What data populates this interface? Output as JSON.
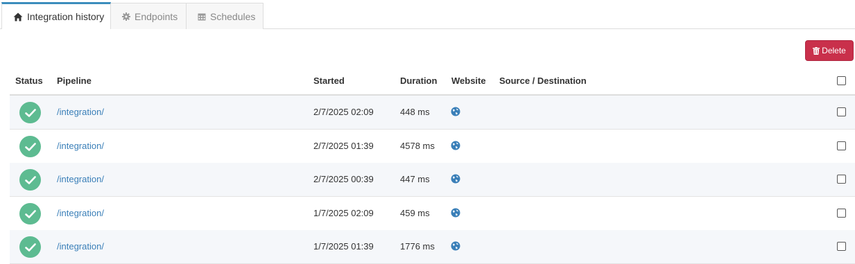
{
  "tabs": [
    {
      "label": "Integration history",
      "icon": "home-icon",
      "active": true
    },
    {
      "label": "Endpoints",
      "icon": "gear-icon",
      "active": false
    },
    {
      "label": "Schedules",
      "icon": "calendar-icon",
      "active": false
    }
  ],
  "toolbar": {
    "delete_label": "Delete",
    "delete_color": "#c9304b"
  },
  "table": {
    "headers": {
      "status": "Status",
      "pipeline": "Pipeline",
      "started": "Started",
      "duration": "Duration",
      "website": "Website",
      "source_destination": "Source / Destination"
    },
    "rows": [
      {
        "status": "success",
        "pipeline": "/integration/",
        "started": "2/7/2025 02:09",
        "duration": "448 ms",
        "website": "globe-icon",
        "source_destination": ""
      },
      {
        "status": "success",
        "pipeline": "/integration/",
        "started": "2/7/2025 01:39",
        "duration": "4578 ms",
        "website": "globe-icon",
        "source_destination": ""
      },
      {
        "status": "success",
        "pipeline": "/integration/",
        "started": "2/7/2025 00:39",
        "duration": "447 ms",
        "website": "globe-icon",
        "source_destination": ""
      },
      {
        "status": "success",
        "pipeline": "/integration/",
        "started": "1/7/2025 02:09",
        "duration": "459 ms",
        "website": "globe-icon",
        "source_destination": ""
      },
      {
        "status": "success",
        "pipeline": "/integration/",
        "started": "1/7/2025 01:39",
        "duration": "1776 ms",
        "website": "globe-icon",
        "source_destination": ""
      }
    ]
  },
  "colors": {
    "accent": "#3c8dbc",
    "success": "#5dbb91",
    "link": "#3a7fb8"
  }
}
